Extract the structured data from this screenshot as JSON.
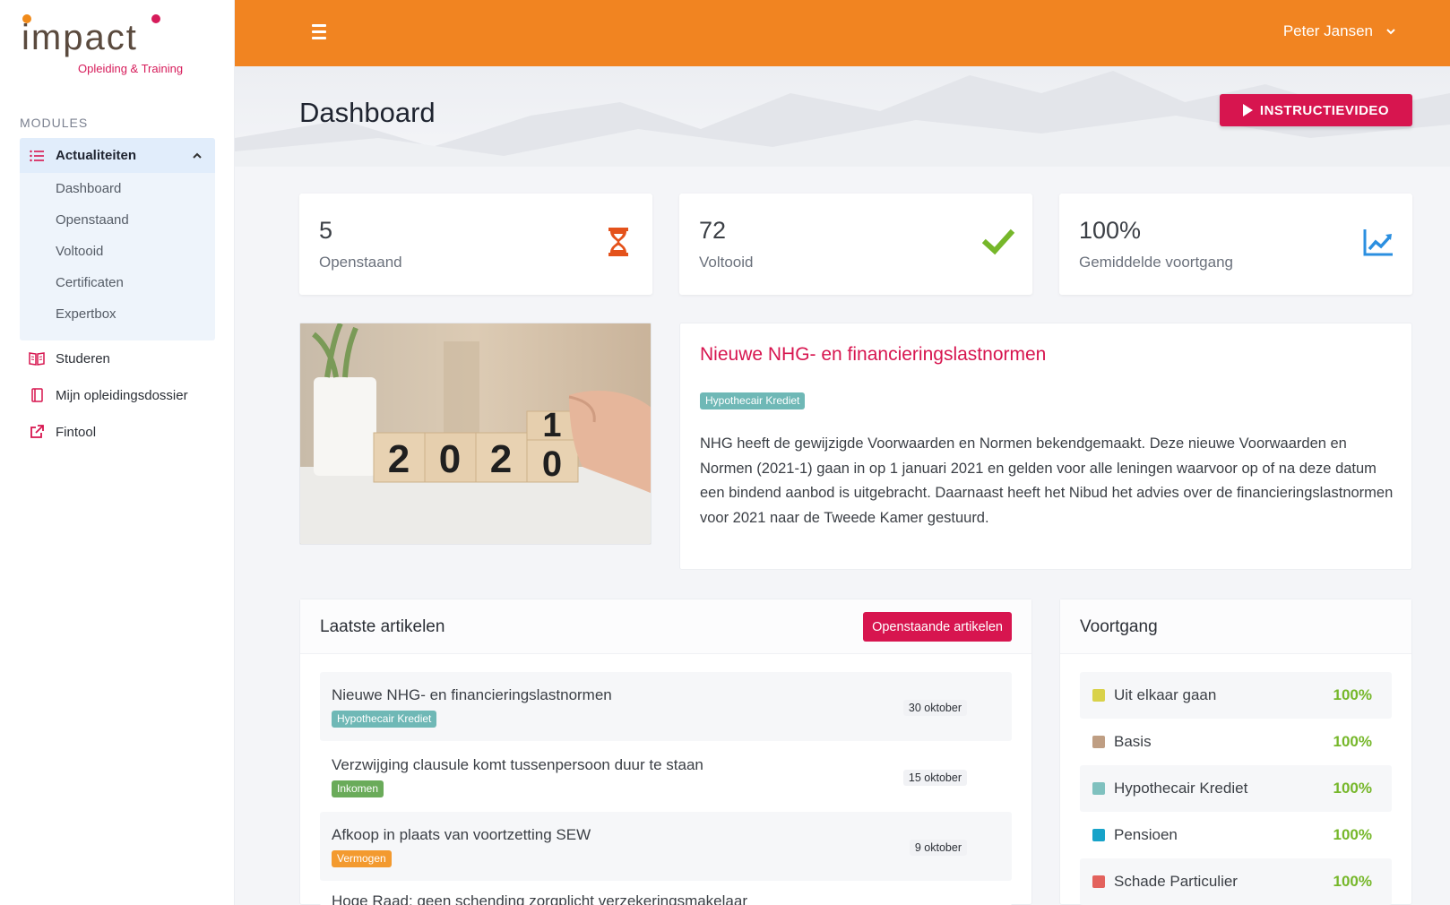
{
  "brand": {
    "logo_text": "impact",
    "logo_sub": "Opleiding & Training"
  },
  "sidebar": {
    "section_label": "MODULES",
    "group": {
      "label": "Actualiteiten",
      "icon": "list-icon",
      "items": [
        {
          "label": "Dashboard"
        },
        {
          "label": "Openstaand"
        },
        {
          "label": "Voltooid"
        },
        {
          "label": "Certificaten"
        },
        {
          "label": "Expertbox"
        }
      ]
    },
    "items": [
      {
        "label": "Studeren",
        "icon": "book-open-icon"
      },
      {
        "label": "Mijn opleidingsdossier",
        "icon": "book-icon"
      },
      {
        "label": "Fintool",
        "icon": "external-link-icon"
      }
    ]
  },
  "topbar": {
    "user_name": "Peter Jansen"
  },
  "page": {
    "title": "Dashboard",
    "video_button": "INSTRUCTIEVIDEO"
  },
  "stats": [
    {
      "value": "5",
      "label": "Openstaand",
      "icon": "hourglass-icon",
      "color": "#e4521b"
    },
    {
      "value": "72",
      "label": "Voltooid",
      "icon": "check-icon",
      "color": "#76b72a"
    },
    {
      "value": "100%",
      "label": "Gemiddelde voortgang",
      "icon": "chart-line-icon",
      "color": "#2b8fe0"
    }
  ],
  "featured": {
    "title": "Nieuwe NHG- en financieringslastnormen",
    "tag": "Hypothecair Krediet",
    "body": "NHG heeft de gewijzigde Voorwaarden en Normen bekendgemaakt. Deze nieuwe Voorwaarden en Normen (2021-1) gaan in op 1 januari 2021 en gelden voor alle leningen waarvoor op of na deze datum een bindend aanbod is uitgebracht. Daarnaast heeft het Nibud het advies over de financieringslastnormen voor 2021 naar de Tweede Kamer gestuurd.",
    "image_digits": {
      "d1": "2",
      "d2": "0",
      "d3": "2",
      "d4_top": "1",
      "d4_bottom": "0"
    }
  },
  "latest": {
    "title": "Laatste artikelen",
    "button": "Openstaande artikelen",
    "articles": [
      {
        "title": "Nieuwe NHG- en financieringslastnormen",
        "tag": "Hypothecair Krediet",
        "tag_color": "#6fb8b6",
        "date": "30 oktober"
      },
      {
        "title": "Verzwijging clausule komt tussenpersoon duur te staan",
        "tag": "Inkomen",
        "tag_color": "#6aab5a",
        "date": "15 oktober"
      },
      {
        "title": "Afkoop in plaats van voortzetting SEW",
        "tag": "Vermogen",
        "tag_color": "#f39a2f",
        "date": "9 oktober"
      },
      {
        "title": "Hoge Raad: geen schending zorgplicht verzekeringsmakelaar"
      }
    ]
  },
  "progress": {
    "title": "Voortgang",
    "rows": [
      {
        "name": "Uit elkaar gaan",
        "value": "100%",
        "color": "#d9d24a"
      },
      {
        "name": "Basis",
        "value": "100%",
        "color": "#bf9e83"
      },
      {
        "name": "Hypothecair Krediet",
        "value": "100%",
        "color": "#7fc1bf"
      },
      {
        "name": "Pensioen",
        "value": "100%",
        "color": "#17a3c9"
      },
      {
        "name": "Schade Particulier",
        "value": "100%",
        "color": "#e3625d"
      }
    ]
  }
}
